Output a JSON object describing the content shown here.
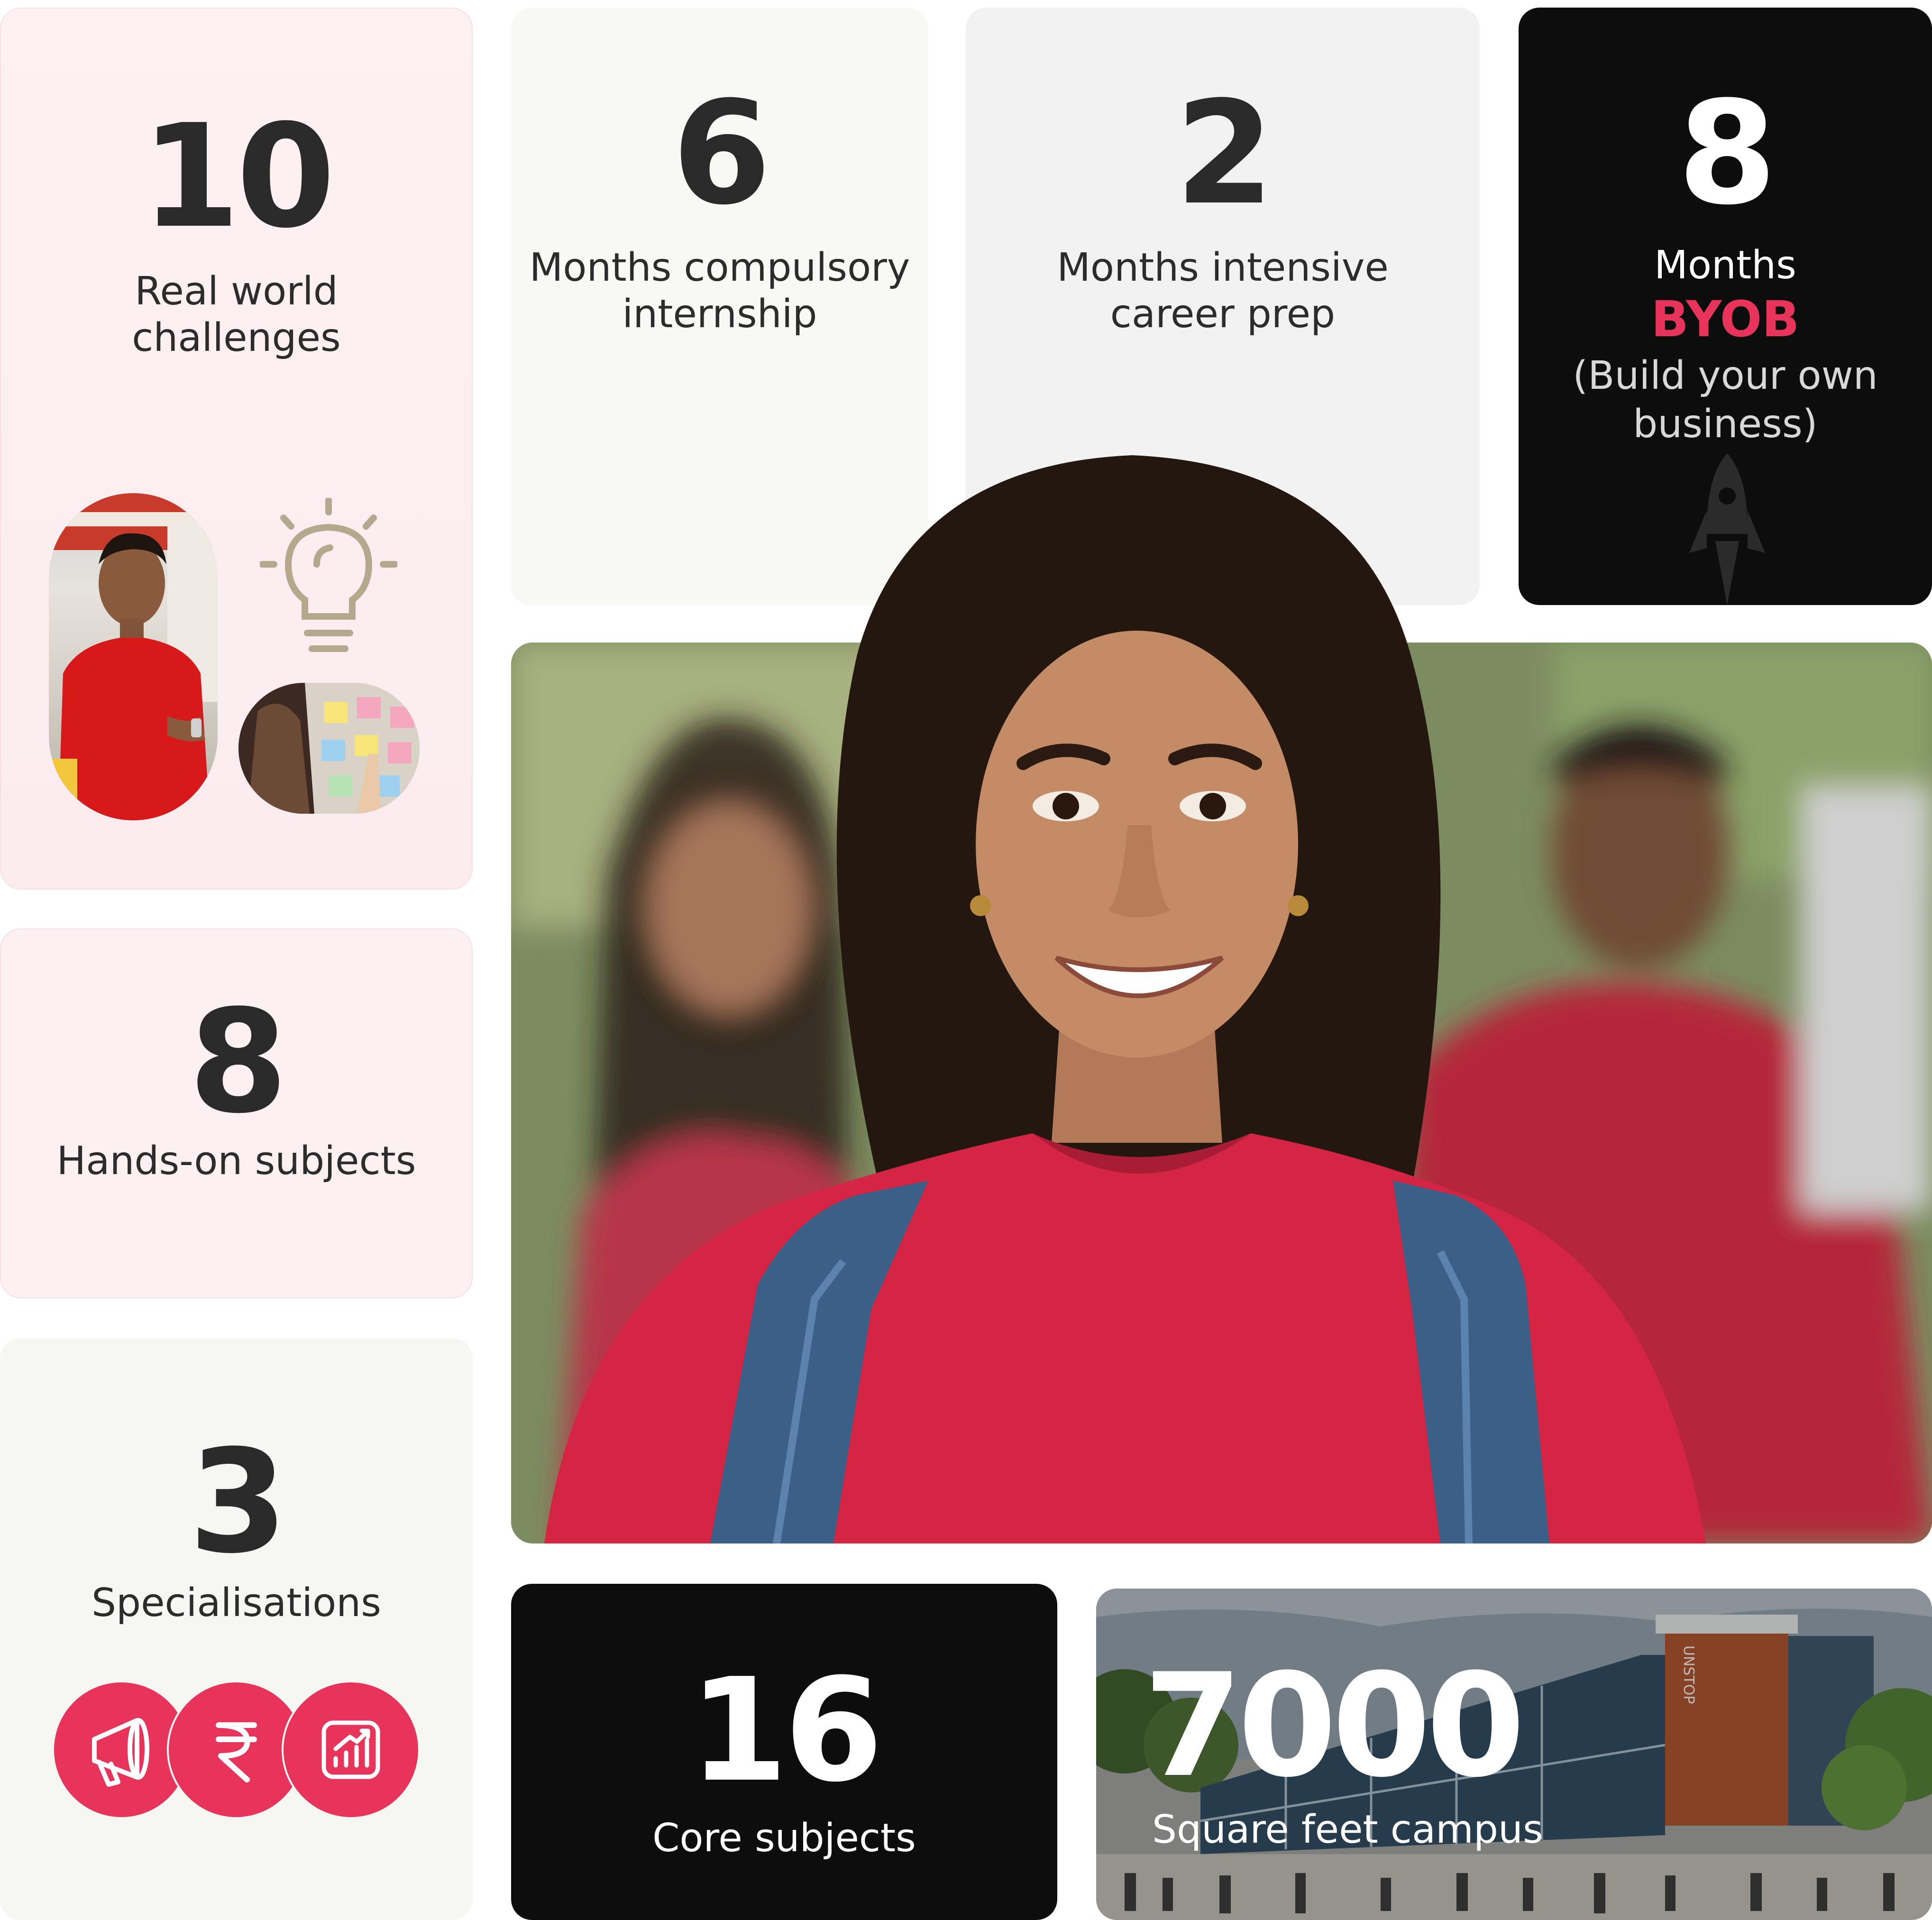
{
  "stats": {
    "challenges": {
      "number": "10",
      "label_line1": "Real world",
      "label_line2": "challenges"
    },
    "internship": {
      "number": "6",
      "label_line1": "Months compulsory",
      "label_line2": "internship"
    },
    "career_prep": {
      "number": "2",
      "label_line1": "Months intensive",
      "label_line2": "career prep"
    },
    "byob": {
      "number": "8",
      "label_line1": "Months",
      "highlight": "BYOB",
      "label_line3": "(Build your own",
      "label_line4": "business)"
    },
    "hands_on": {
      "number": "8",
      "label": "Hands-on subjects"
    },
    "specialisations": {
      "number": "3",
      "label": "Specialisations"
    },
    "core": {
      "number": "16",
      "label": "Core subjects"
    },
    "campus": {
      "number": "7000",
      "label": "Square feet campus",
      "building_sign": "UNSTOP"
    }
  },
  "specialisation_icons": [
    "megaphone-icon",
    "rupee-icon",
    "growth-chart-icon"
  ],
  "colors": {
    "accent": "#e8345a",
    "dark_card": "#0d0d0d",
    "pink_card": "#fdf0f3",
    "light_card": "#f8f8f5",
    "grey_card": "#f2f2f2",
    "bulb": "#b4a98c"
  }
}
